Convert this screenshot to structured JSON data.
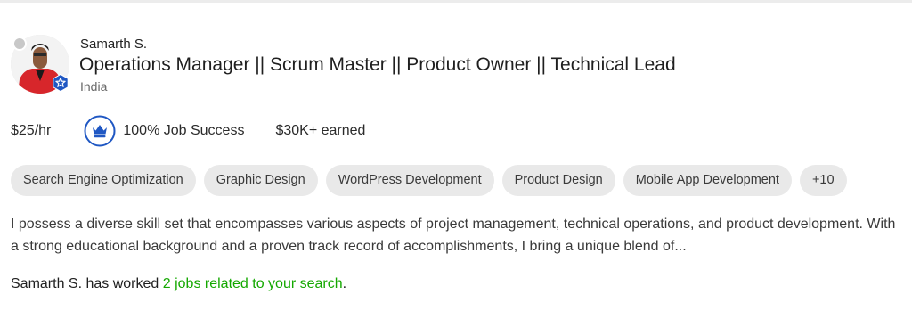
{
  "profile": {
    "name": "Samarth S.",
    "title": "Operations Manager || Scrum Master || Product Owner || Technical Lead",
    "location": "India"
  },
  "stats": {
    "rate": "$25/hr",
    "job_success": "100% Job Success",
    "earned": "$30K+ earned",
    "job_success_icon": "crown-icon"
  },
  "skills": [
    "Search Engine Optimization",
    "Graphic Design",
    "WordPress Development",
    "Product Design",
    "Mobile App Development",
    "+10"
  ],
  "bio": "I possess a diverse skill set that encompasses various aspects of project management, technical operations, and product development. With a strong educational background and a proven track record of accomplishments, I bring a unique blend of...",
  "worked": {
    "prefix": "Samarth S. has worked ",
    "link": "2 jobs related to your search",
    "suffix": "."
  },
  "colors": {
    "accent_green": "#14a800",
    "badge_blue": "#1f57c3",
    "pill_bg": "#e9e9e9"
  }
}
